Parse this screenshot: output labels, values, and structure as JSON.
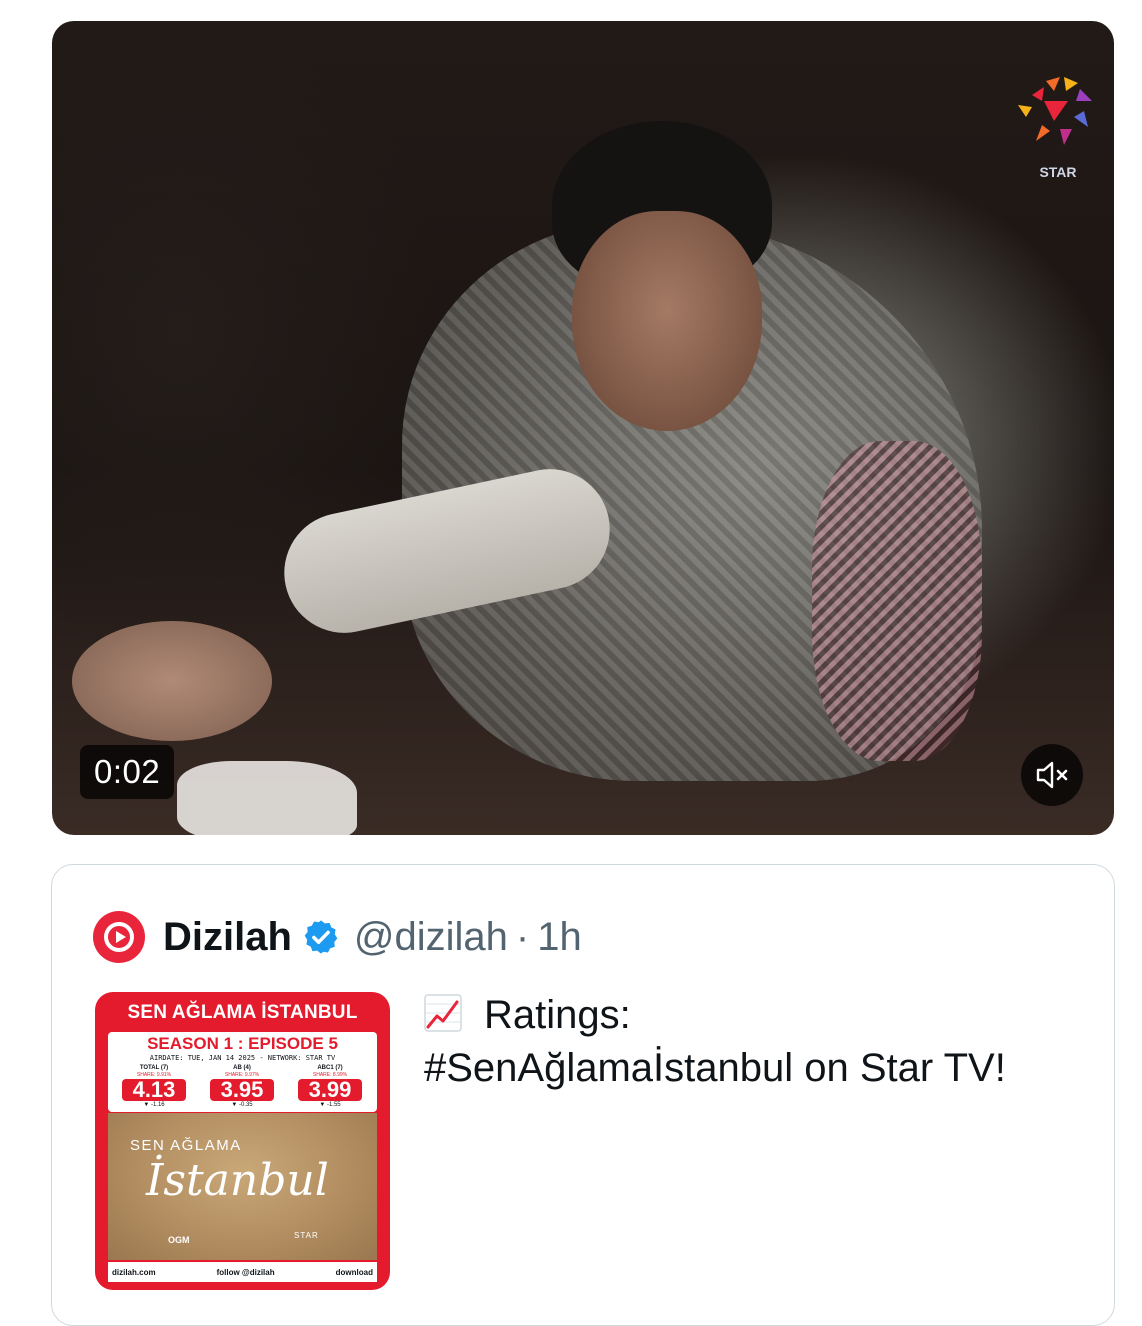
{
  "video": {
    "elapsed_time": "0:02",
    "channel_logo": "STAR",
    "mute_icon": "speaker-muted-icon"
  },
  "quote": {
    "author_name": "Dizilah",
    "handle": "@dizilah",
    "separator": "·",
    "time": "1h",
    "verified": true,
    "text_emoji": "chart-increasing-icon",
    "text_line1": "Ratings:",
    "text_line2": "#SenAğlamaİstanbul on Star TV!",
    "thumbnail": {
      "title": "SEN AĞLAMA İSTANBUL",
      "season": "SEASON 1 : EPISODE 5",
      "airdate": "AIRDATE: TUE, JAN 14 2025 - NETWORK: STAR TV",
      "stats": [
        {
          "label": "TOTAL (7)",
          "share": "SHARE: 9.91%",
          "value": "4.13",
          "delta": "▼ -1.16"
        },
        {
          "label": "AB (4)",
          "share": "SHARE: 9.97%",
          "value": "3.95",
          "delta": "▼ -0.35"
        },
        {
          "label": "ABC1 (7)",
          "share": "SHARE: 8.99%",
          "value": "3.99",
          "delta": "▼ -1.55"
        }
      ],
      "poster_subtitle": "SEN AĞLAMA",
      "poster_title": "İstanbul",
      "poster_ogm": "OGM",
      "poster_star": "STAR",
      "footer_site": "dizilah.com",
      "footer_follow": "follow @dizilah",
      "footer_download": "download"
    }
  },
  "colors": {
    "accent_red": "#e31b2c",
    "verified_blue": "#1d9bf0",
    "text_primary": "#0f1419",
    "text_secondary": "#536471",
    "card_border": "#cfd9de"
  }
}
